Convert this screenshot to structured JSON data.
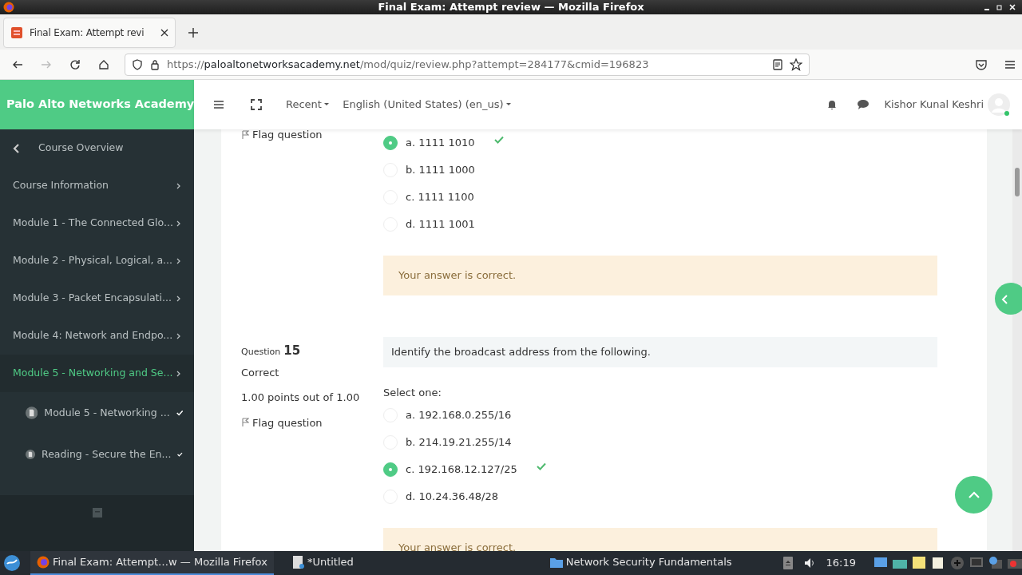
{
  "window": {
    "title": "Final Exam: Attempt review — Mozilla Firefox"
  },
  "browser": {
    "tabs": [
      {
        "title": "Final Exam: Attempt revi",
        "selected": true
      }
    ],
    "url": {
      "scheme": "https://",
      "host": "paloaltonetworksacademy.net",
      "path": "/mod/quiz/review.php?attempt=284177&cmid=196823"
    }
  },
  "site": {
    "brand": "Palo Alto Networks Academy",
    "nav_items": [
      {
        "label": "Recent"
      },
      {
        "label": "English (United States) (en_us)"
      }
    ],
    "user_name": "Kishor Kunal Keshri"
  },
  "sidebar": {
    "back_item": "Course Overview",
    "items": [
      {
        "label": "Course Information",
        "active": false
      },
      {
        "label": "Module 1 - The Connected Glo...",
        "active": false
      },
      {
        "label": "Module 2 - Physical, Logical, a...",
        "active": false
      },
      {
        "label": "Module 3 - Packet Encapsulati...",
        "active": false
      },
      {
        "label": "Module 4: Network and Endpo...",
        "active": false
      },
      {
        "label": "Module 5 - Networking and Se...",
        "active": true,
        "children": [
          {
            "label": "Module 5 - Networking ...",
            "completed": true
          },
          {
            "label": "Reading - Secure the En...",
            "completed": true
          }
        ]
      }
    ]
  },
  "questions": [
    {
      "flag_label": "Flag question",
      "options": [
        {
          "label": "a. 1111 1010",
          "selected": true,
          "correct": true
        },
        {
          "label": "b. 1111 1000",
          "selected": false,
          "correct": false
        },
        {
          "label": "c. 1111 1100",
          "selected": false,
          "correct": false
        },
        {
          "label": "d. 1111 1001",
          "selected": false,
          "correct": false
        }
      ],
      "feedback": "Your answer is correct."
    },
    {
      "number_label": "Question",
      "number": "15",
      "state": "Correct",
      "points": "1.00 points out of 1.00",
      "flag_label": "Flag question",
      "prompt": "Identify the broadcast address from the following.",
      "select_label": "Select one:",
      "options": [
        {
          "label": "a. 192.168.0.255/16",
          "selected": false,
          "correct": false
        },
        {
          "label": "b. 214.19.21.255/14",
          "selected": false,
          "correct": false
        },
        {
          "label": "c. 192.168.12.127/25",
          "selected": true,
          "correct": true
        },
        {
          "label": "d. 10.24.36.48/28",
          "selected": false,
          "correct": false
        }
      ],
      "feedback": "Your answer is correct."
    }
  ],
  "taskbar": {
    "tasks": [
      {
        "label": "Final Exam: Attempt…w — Mozilla Firefox",
        "kind": "browser",
        "selected": true
      },
      {
        "label": "*Untitled",
        "kind": "editor",
        "selected": false
      },
      {
        "label": "Network Security Fundamentals",
        "kind": "folder",
        "selected": false
      }
    ],
    "time": "16:19"
  }
}
